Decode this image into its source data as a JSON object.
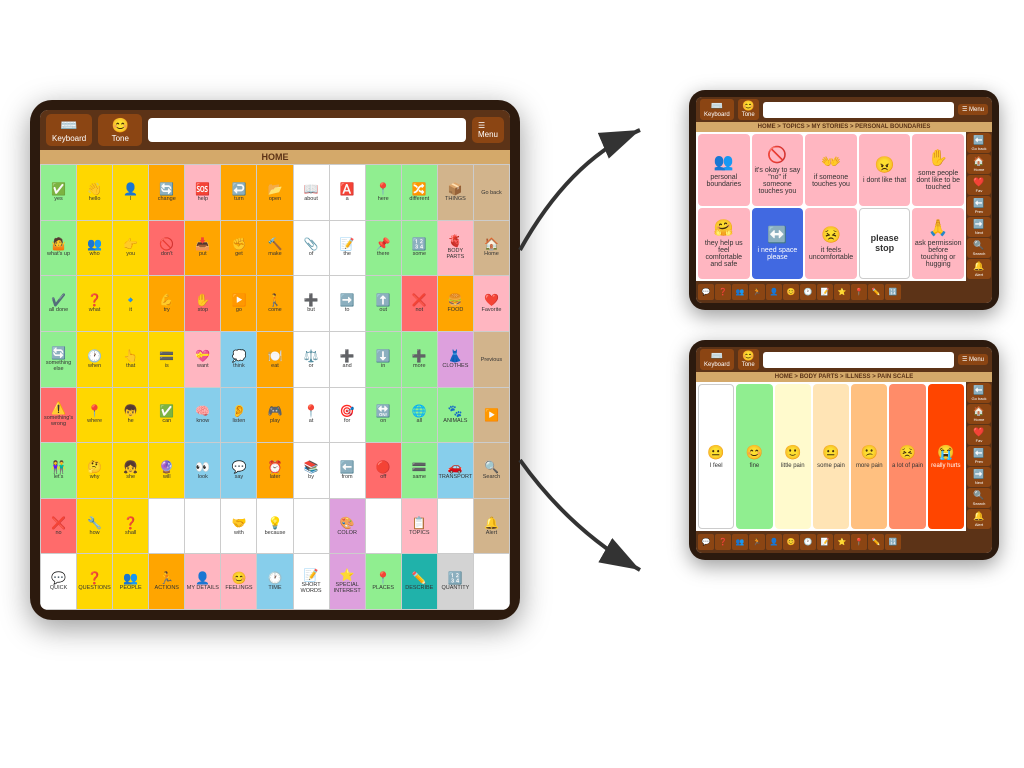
{
  "left_tablet": {
    "top_bar": {
      "keyboard_label": "Keyboard",
      "tone_label": "Tone",
      "menu_label": "Menu"
    },
    "home_label": "HOME",
    "grid_rows": [
      [
        {
          "label": "yes",
          "color": "green",
          "sym": "✅"
        },
        {
          "label": "hello",
          "color": "yellow",
          "sym": "👋"
        },
        {
          "label": "I",
          "color": "yellow",
          "sym": "👤"
        },
        {
          "label": "change",
          "color": "orange",
          "sym": "🔄"
        },
        {
          "label": "help",
          "color": "pink",
          "sym": "🆘"
        },
        {
          "label": "turn",
          "color": "orange",
          "sym": "↩️"
        },
        {
          "label": "open",
          "color": "orange",
          "sym": "📂"
        },
        {
          "label": "about",
          "color": "white",
          "sym": "📖"
        },
        {
          "label": "a",
          "color": "white",
          "sym": "🅰️"
        },
        {
          "label": "here",
          "color": "green",
          "sym": "📍"
        },
        {
          "label": "different",
          "color": "green",
          "sym": "🔀"
        },
        {
          "label": "THINGS",
          "color": "tan",
          "sym": "📦"
        },
        {
          "label": "Go back",
          "color": "tan",
          "sym": "⬅️"
        }
      ],
      [
        {
          "label": "what's up",
          "color": "green",
          "sym": "🤷"
        },
        {
          "label": "who",
          "color": "yellow",
          "sym": "👥"
        },
        {
          "label": "you",
          "color": "yellow",
          "sym": "👉"
        },
        {
          "label": "don't",
          "color": "red",
          "sym": "🚫"
        },
        {
          "label": "put",
          "color": "orange",
          "sym": "📥"
        },
        {
          "label": "get",
          "color": "orange",
          "sym": "✊"
        },
        {
          "label": "make",
          "color": "orange",
          "sym": "🔨"
        },
        {
          "label": "of",
          "color": "white",
          "sym": "📎"
        },
        {
          "label": "the",
          "color": "white",
          "sym": "📝"
        },
        {
          "label": "there",
          "color": "green",
          "sym": "📌"
        },
        {
          "label": "some",
          "color": "green",
          "sym": "🔢"
        },
        {
          "label": "BODY PARTS",
          "color": "pink",
          "sym": "🫀"
        },
        {
          "label": "Home",
          "color": "tan",
          "sym": "🏠"
        }
      ],
      [
        {
          "label": "all done",
          "color": "green",
          "sym": "✔️"
        },
        {
          "label": "what",
          "color": "yellow",
          "sym": "❓"
        },
        {
          "label": "it",
          "color": "yellow",
          "sym": "🔹"
        },
        {
          "label": "try",
          "color": "orange",
          "sym": "💪"
        },
        {
          "label": "stop",
          "color": "red",
          "sym": "✋"
        },
        {
          "label": "go",
          "color": "orange",
          "sym": "▶️"
        },
        {
          "label": "come",
          "color": "orange",
          "sym": "🚶"
        },
        {
          "label": "but",
          "color": "white",
          "sym": "➕"
        },
        {
          "label": "to",
          "color": "white",
          "sym": "➡️"
        },
        {
          "label": "out",
          "color": "green",
          "sym": "⬆️"
        },
        {
          "label": "not",
          "color": "red",
          "sym": "❌"
        },
        {
          "label": "FOOD",
          "color": "orange",
          "sym": "🍔"
        },
        {
          "label": "Favorite",
          "color": "pink",
          "sym": "❤️"
        }
      ],
      [
        {
          "label": "something else",
          "color": "green",
          "sym": "🔄"
        },
        {
          "label": "when",
          "color": "yellow",
          "sym": "🕐"
        },
        {
          "label": "that",
          "color": "yellow",
          "sym": "👆"
        },
        {
          "label": "is",
          "color": "yellow",
          "sym": "🟰"
        },
        {
          "label": "want",
          "color": "pink",
          "sym": "💝"
        },
        {
          "label": "think",
          "color": "blue",
          "sym": "💭"
        },
        {
          "label": "eat",
          "color": "orange",
          "sym": "🍽️"
        },
        {
          "label": "or",
          "color": "white",
          "sym": "⚖️"
        },
        {
          "label": "and",
          "color": "white",
          "sym": "➕"
        },
        {
          "label": "in",
          "color": "green",
          "sym": "⬇️"
        },
        {
          "label": "more",
          "color": "green",
          "sym": "➕"
        },
        {
          "label": "CLOTHES",
          "color": "purple",
          "sym": "👗"
        },
        {
          "label": "Previous",
          "color": "tan",
          "sym": "⬅️"
        }
      ],
      [
        {
          "label": "something's wrong",
          "color": "red",
          "sym": "⚠️"
        },
        {
          "label": "where",
          "color": "yellow",
          "sym": "📍"
        },
        {
          "label": "he",
          "color": "yellow",
          "sym": "👦"
        },
        {
          "label": "can",
          "color": "yellow",
          "sym": "✅"
        },
        {
          "label": "know",
          "color": "blue",
          "sym": "🧠"
        },
        {
          "label": "listen",
          "color": "blue",
          "sym": "👂"
        },
        {
          "label": "play",
          "color": "orange",
          "sym": "🎮"
        },
        {
          "label": "at",
          "color": "white",
          "sym": "📍"
        },
        {
          "label": "for",
          "color": "white",
          "sym": "🎯"
        },
        {
          "label": "on",
          "color": "green",
          "sym": "🔛"
        },
        {
          "label": "all",
          "color": "green",
          "sym": "🌐"
        },
        {
          "label": "ANIMALS",
          "color": "green",
          "sym": "🐾"
        },
        {
          "label": "▶",
          "color": "tan",
          "sym": "▶️"
        }
      ],
      [
        {
          "label": "let's",
          "color": "green",
          "sym": "👫"
        },
        {
          "label": "why",
          "color": "yellow",
          "sym": "🤔"
        },
        {
          "label": "she",
          "color": "yellow",
          "sym": "👧"
        },
        {
          "label": "will",
          "color": "yellow",
          "sym": "🔮"
        },
        {
          "label": "look",
          "color": "blue",
          "sym": "👀"
        },
        {
          "label": "say",
          "color": "blue",
          "sym": "💬"
        },
        {
          "label": "later",
          "color": "orange",
          "sym": "⏰"
        },
        {
          "label": "by",
          "color": "white",
          "sym": "📚"
        },
        {
          "label": "from",
          "color": "white",
          "sym": "⬅️"
        },
        {
          "label": "off",
          "color": "red",
          "sym": "🔴"
        },
        {
          "label": "same",
          "color": "green",
          "sym": "🟰"
        },
        {
          "label": "TRANSPORT",
          "color": "blue",
          "sym": "🚗"
        },
        {
          "label": "Search",
          "color": "tan",
          "sym": "🔍"
        }
      ],
      [
        {
          "label": "no",
          "color": "red",
          "sym": "❌"
        },
        {
          "label": "how",
          "color": "yellow",
          "sym": "🔧"
        },
        {
          "label": "shall",
          "color": "yellow",
          "sym": "❓"
        },
        {
          "label": "",
          "color": "white",
          "sym": ""
        },
        {
          "label": "",
          "color": "white",
          "sym": ""
        },
        {
          "label": "with",
          "color": "white",
          "sym": "🤝"
        },
        {
          "label": "because",
          "color": "white",
          "sym": "💡"
        },
        {
          "label": "",
          "color": "white",
          "sym": ""
        },
        {
          "label": "COLOR",
          "color": "purple",
          "sym": "🎨"
        },
        {
          "label": "",
          "color": "white",
          "sym": ""
        },
        {
          "label": "TOPICS",
          "color": "pink",
          "sym": "📋"
        },
        {
          "label": "",
          "color": "white",
          "sym": ""
        },
        {
          "label": "Alert",
          "color": "tan",
          "sym": "🔔"
        }
      ],
      [
        {
          "label": "QUICK",
          "color": "white",
          "sym": "💬"
        },
        {
          "label": "QUESTIONS",
          "color": "yellow",
          "sym": "❓"
        },
        {
          "label": "PEOPLE",
          "color": "yellow",
          "sym": "👥"
        },
        {
          "label": "ACTIONS",
          "color": "orange",
          "sym": "🏃"
        },
        {
          "label": "MY DETAILS",
          "color": "pink",
          "sym": "👤"
        },
        {
          "label": "FEELINGS",
          "color": "pink",
          "sym": "😊"
        },
        {
          "label": "TIME",
          "color": "blue",
          "sym": "🕐"
        },
        {
          "label": "SHORT WORDS",
          "color": "white",
          "sym": "📝"
        },
        {
          "label": "SPECIAL INTEREST",
          "color": "purple",
          "sym": "⭐"
        },
        {
          "label": "PLACES",
          "color": "green",
          "sym": "📍"
        },
        {
          "label": "DESCRIBE",
          "color": "teal",
          "sym": "✏️"
        },
        {
          "label": "QUANTITY",
          "color": "lgray",
          "sym": "🔢"
        },
        {
          "label": "",
          "color": "white",
          "sym": ""
        }
      ]
    ],
    "sidebar_buttons": [
      "Go back",
      "Home",
      "Favorite",
      "Previous",
      "",
      "Search",
      "Alert"
    ]
  },
  "right_top_tablet": {
    "breadcrumb": "HOME > TOPICS > MY STORIES > PERSONAL BOUNDARIES",
    "title": "personal boundaries",
    "cells": [
      {
        "label": "personal boundaries",
        "color": "#FFB6C1",
        "sym": "👥"
      },
      {
        "label": "it's okay to say \"no\" if someone touches you",
        "color": "#FFB6C1",
        "sym": "🚫"
      },
      {
        "label": "if someone touches you",
        "color": "#FFB6C1",
        "sym": "👐"
      },
      {
        "label": "i dont like that",
        "color": "#FFB6C1",
        "sym": "😠"
      },
      {
        "label": "some people dont like to be touched",
        "color": "#FFB6C1",
        "sym": "✋"
      },
      {
        "label": "they help us feel comfortable and safe",
        "color": "#FFB6C1",
        "sym": "🤗"
      },
      {
        "label": "i need space please",
        "color": "#4169E1",
        "sym": "↔️"
      },
      {
        "label": "it feels uncomfortable",
        "color": "#FFB6C1",
        "sym": "😣"
      },
      {
        "label": "please stop",
        "color": "#ffffff",
        "sym": "🛑"
      },
      {
        "label": "ask permission before touching or hugging",
        "color": "#FFB6C1",
        "sym": "🙏"
      }
    ],
    "sidebar_buttons": [
      "Go back",
      "Home",
      "Favorite",
      "Previous",
      "Next",
      "Search",
      "Alert"
    ]
  },
  "right_bottom_tablet": {
    "breadcrumb": "HOME > BODY PARTS > ILLNESS > PAIN SCALE",
    "cells": [
      {
        "label": "I feel",
        "color": "#ffffff",
        "sym": "😐",
        "special": "output"
      },
      {
        "label": "fine",
        "color": "#90EE90",
        "sym": "😊"
      },
      {
        "label": "little pain",
        "color": "#FFFACD",
        "sym": "🙂"
      },
      {
        "label": "some pain",
        "color": "#FFE4B5",
        "sym": "😐"
      },
      {
        "label": "more pain",
        "color": "#FFC080",
        "sym": "😕"
      },
      {
        "label": "a lot of pain",
        "color": "#FF8C69",
        "sym": "😣"
      },
      {
        "label": "really hurts",
        "color": "#FF4500",
        "sym": "😭"
      }
    ],
    "sidebar_buttons": [
      "Go back",
      "Home",
      "Favorite",
      "Previous",
      "Next",
      "Search",
      "Alert"
    ]
  },
  "arrows": {
    "top_label": "→",
    "bottom_label": "→"
  }
}
